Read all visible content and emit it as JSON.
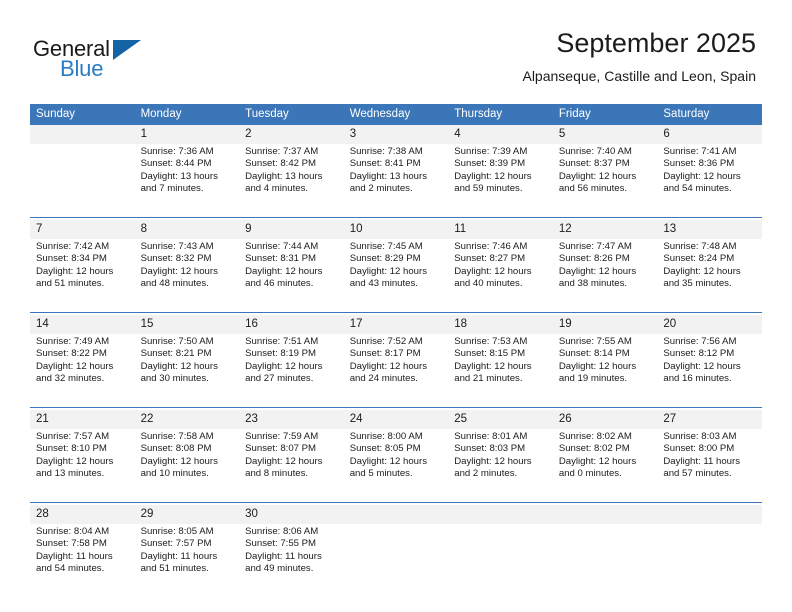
{
  "brand": {
    "name_part1": "General",
    "name_part2": "Blue",
    "triangle_color": "#1464a5",
    "blue_text_color": "#2b7cc4"
  },
  "header": {
    "title": "September 2025",
    "subtitle": "Alpanseque, Castille and Leon, Spain",
    "header_bg_color": "#3b76b8",
    "daynum_bg_color": "#f2f2f2"
  },
  "weekday_headers": [
    "Sunday",
    "Monday",
    "Tuesday",
    "Wednesday",
    "Thursday",
    "Friday",
    "Saturday"
  ],
  "weeks": [
    {
      "days": [
        {
          "num": "",
          "sunrise": "",
          "sunset": "",
          "daylight1": "",
          "daylight2": ""
        },
        {
          "num": "1",
          "sunrise": "Sunrise: 7:36 AM",
          "sunset": "Sunset: 8:44 PM",
          "daylight1": "Daylight: 13 hours",
          "daylight2": "and 7 minutes."
        },
        {
          "num": "2",
          "sunrise": "Sunrise: 7:37 AM",
          "sunset": "Sunset: 8:42 PM",
          "daylight1": "Daylight: 13 hours",
          "daylight2": "and 4 minutes."
        },
        {
          "num": "3",
          "sunrise": "Sunrise: 7:38 AM",
          "sunset": "Sunset: 8:41 PM",
          "daylight1": "Daylight: 13 hours",
          "daylight2": "and 2 minutes."
        },
        {
          "num": "4",
          "sunrise": "Sunrise: 7:39 AM",
          "sunset": "Sunset: 8:39 PM",
          "daylight1": "Daylight: 12 hours",
          "daylight2": "and 59 minutes."
        },
        {
          "num": "5",
          "sunrise": "Sunrise: 7:40 AM",
          "sunset": "Sunset: 8:37 PM",
          "daylight1": "Daylight: 12 hours",
          "daylight2": "and 56 minutes."
        },
        {
          "num": "6",
          "sunrise": "Sunrise: 7:41 AM",
          "sunset": "Sunset: 8:36 PM",
          "daylight1": "Daylight: 12 hours",
          "daylight2": "and 54 minutes."
        }
      ]
    },
    {
      "days": [
        {
          "num": "7",
          "sunrise": "Sunrise: 7:42 AM",
          "sunset": "Sunset: 8:34 PM",
          "daylight1": "Daylight: 12 hours",
          "daylight2": "and 51 minutes."
        },
        {
          "num": "8",
          "sunrise": "Sunrise: 7:43 AM",
          "sunset": "Sunset: 8:32 PM",
          "daylight1": "Daylight: 12 hours",
          "daylight2": "and 48 minutes."
        },
        {
          "num": "9",
          "sunrise": "Sunrise: 7:44 AM",
          "sunset": "Sunset: 8:31 PM",
          "daylight1": "Daylight: 12 hours",
          "daylight2": "and 46 minutes."
        },
        {
          "num": "10",
          "sunrise": "Sunrise: 7:45 AM",
          "sunset": "Sunset: 8:29 PM",
          "daylight1": "Daylight: 12 hours",
          "daylight2": "and 43 minutes."
        },
        {
          "num": "11",
          "sunrise": "Sunrise: 7:46 AM",
          "sunset": "Sunset: 8:27 PM",
          "daylight1": "Daylight: 12 hours",
          "daylight2": "and 40 minutes."
        },
        {
          "num": "12",
          "sunrise": "Sunrise: 7:47 AM",
          "sunset": "Sunset: 8:26 PM",
          "daylight1": "Daylight: 12 hours",
          "daylight2": "and 38 minutes."
        },
        {
          "num": "13",
          "sunrise": "Sunrise: 7:48 AM",
          "sunset": "Sunset: 8:24 PM",
          "daylight1": "Daylight: 12 hours",
          "daylight2": "and 35 minutes."
        }
      ]
    },
    {
      "days": [
        {
          "num": "14",
          "sunrise": "Sunrise: 7:49 AM",
          "sunset": "Sunset: 8:22 PM",
          "daylight1": "Daylight: 12 hours",
          "daylight2": "and 32 minutes."
        },
        {
          "num": "15",
          "sunrise": "Sunrise: 7:50 AM",
          "sunset": "Sunset: 8:21 PM",
          "daylight1": "Daylight: 12 hours",
          "daylight2": "and 30 minutes."
        },
        {
          "num": "16",
          "sunrise": "Sunrise: 7:51 AM",
          "sunset": "Sunset: 8:19 PM",
          "daylight1": "Daylight: 12 hours",
          "daylight2": "and 27 minutes."
        },
        {
          "num": "17",
          "sunrise": "Sunrise: 7:52 AM",
          "sunset": "Sunset: 8:17 PM",
          "daylight1": "Daylight: 12 hours",
          "daylight2": "and 24 minutes."
        },
        {
          "num": "18",
          "sunrise": "Sunrise: 7:53 AM",
          "sunset": "Sunset: 8:15 PM",
          "daylight1": "Daylight: 12 hours",
          "daylight2": "and 21 minutes."
        },
        {
          "num": "19",
          "sunrise": "Sunrise: 7:55 AM",
          "sunset": "Sunset: 8:14 PM",
          "daylight1": "Daylight: 12 hours",
          "daylight2": "and 19 minutes."
        },
        {
          "num": "20",
          "sunrise": "Sunrise: 7:56 AM",
          "sunset": "Sunset: 8:12 PM",
          "daylight1": "Daylight: 12 hours",
          "daylight2": "and 16 minutes."
        }
      ]
    },
    {
      "days": [
        {
          "num": "21",
          "sunrise": "Sunrise: 7:57 AM",
          "sunset": "Sunset: 8:10 PM",
          "daylight1": "Daylight: 12 hours",
          "daylight2": "and 13 minutes."
        },
        {
          "num": "22",
          "sunrise": "Sunrise: 7:58 AM",
          "sunset": "Sunset: 8:08 PM",
          "daylight1": "Daylight: 12 hours",
          "daylight2": "and 10 minutes."
        },
        {
          "num": "23",
          "sunrise": "Sunrise: 7:59 AM",
          "sunset": "Sunset: 8:07 PM",
          "daylight1": "Daylight: 12 hours",
          "daylight2": "and 8 minutes."
        },
        {
          "num": "24",
          "sunrise": "Sunrise: 8:00 AM",
          "sunset": "Sunset: 8:05 PM",
          "daylight1": "Daylight: 12 hours",
          "daylight2": "and 5 minutes."
        },
        {
          "num": "25",
          "sunrise": "Sunrise: 8:01 AM",
          "sunset": "Sunset: 8:03 PM",
          "daylight1": "Daylight: 12 hours",
          "daylight2": "and 2 minutes."
        },
        {
          "num": "26",
          "sunrise": "Sunrise: 8:02 AM",
          "sunset": "Sunset: 8:02 PM",
          "daylight1": "Daylight: 12 hours",
          "daylight2": "and 0 minutes."
        },
        {
          "num": "27",
          "sunrise": "Sunrise: 8:03 AM",
          "sunset": "Sunset: 8:00 PM",
          "daylight1": "Daylight: 11 hours",
          "daylight2": "and 57 minutes."
        }
      ]
    },
    {
      "days": [
        {
          "num": "28",
          "sunrise": "Sunrise: 8:04 AM",
          "sunset": "Sunset: 7:58 PM",
          "daylight1": "Daylight: 11 hours",
          "daylight2": "and 54 minutes."
        },
        {
          "num": "29",
          "sunrise": "Sunrise: 8:05 AM",
          "sunset": "Sunset: 7:57 PM",
          "daylight1": "Daylight: 11 hours",
          "daylight2": "and 51 minutes."
        },
        {
          "num": "30",
          "sunrise": "Sunrise: 8:06 AM",
          "sunset": "Sunset: 7:55 PM",
          "daylight1": "Daylight: 11 hours",
          "daylight2": "and 49 minutes."
        },
        {
          "num": "",
          "sunrise": "",
          "sunset": "",
          "daylight1": "",
          "daylight2": ""
        },
        {
          "num": "",
          "sunrise": "",
          "sunset": "",
          "daylight1": "",
          "daylight2": ""
        },
        {
          "num": "",
          "sunrise": "",
          "sunset": "",
          "daylight1": "",
          "daylight2": ""
        },
        {
          "num": "",
          "sunrise": "",
          "sunset": "",
          "daylight1": "",
          "daylight2": ""
        }
      ]
    }
  ]
}
